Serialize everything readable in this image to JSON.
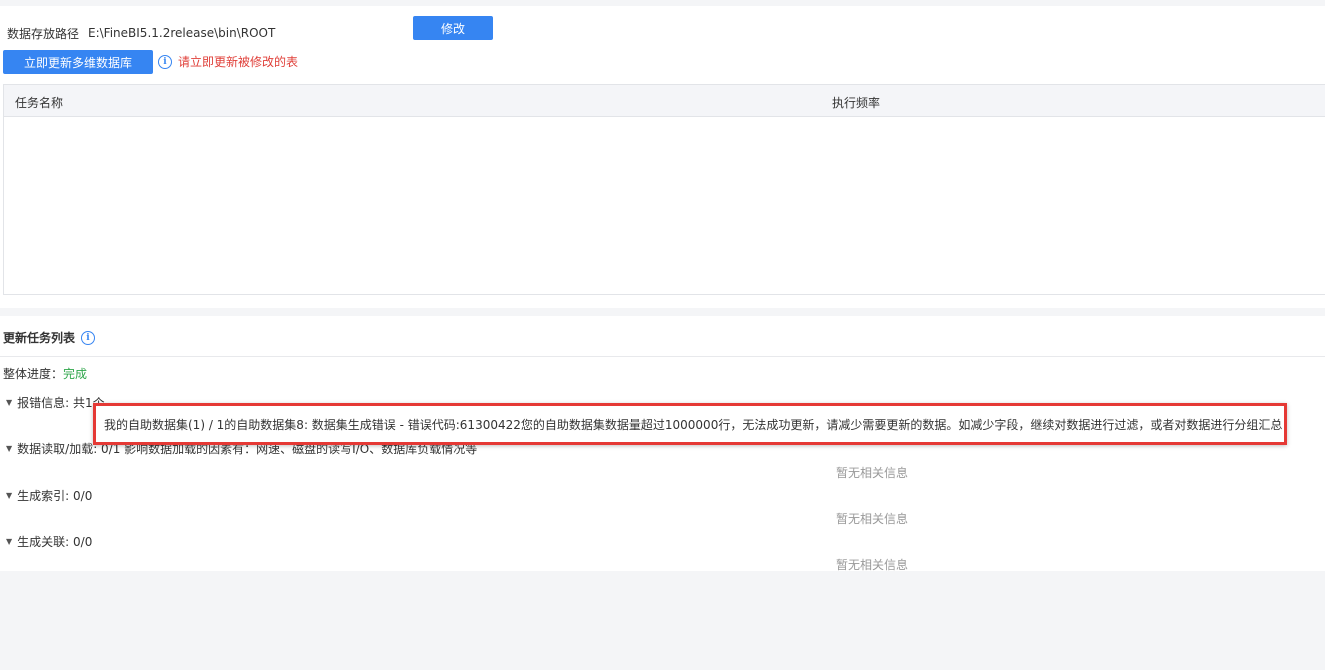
{
  "settings": {
    "path_label": "数据存放路径",
    "path_value": "E:\\FineBI5.1.2release\\bin\\ROOT",
    "modify_label": "修改",
    "update_button_label": "立即更新多维数据库",
    "tip_text": "请立即更新被修改的表"
  },
  "task_table": {
    "columns": [
      "任务名称",
      "执行频率"
    ],
    "rows": []
  },
  "update_list": {
    "title": "更新任务列表",
    "progress_label": "整体进度：",
    "progress_value": "完成",
    "sections": [
      {
        "label": "报错信息: 共1个"
      },
      {
        "label": "数据读取/加载: 0/1 影响数据加载的因素有：网速、磁盘的读写I/O、数据库负载情况等",
        "empty": "暂无相关信息"
      },
      {
        "label": "生成索引: 0/0",
        "empty": "暂无相关信息"
      },
      {
        "label": "生成关联: 0/0",
        "empty": "暂无相关信息"
      }
    ]
  },
  "error_popup": {
    "text": "我的自助数据集(1) / 1的自助数据集8: 数据集生成错误 - 错误代码:61300422您的自助数据集数据量超过1000000行，无法成功更新，请减少需要更新的数据。如减少字段，继续对数据进行过滤，或者对数据进行分组汇总"
  },
  "icons": {
    "info": "info-icon",
    "caret": "caret-down-icon"
  },
  "colors": {
    "primary": "#3685f2",
    "tip_red": "#e0403a",
    "success_green": "#2ea64a",
    "highlight_red": "#e53935"
  }
}
